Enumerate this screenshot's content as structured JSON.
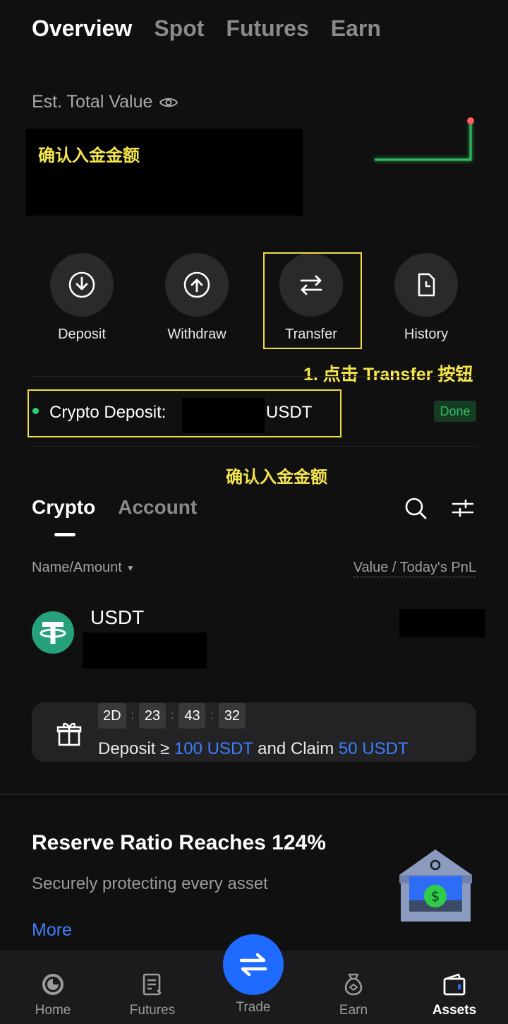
{
  "top_tabs": [
    {
      "label": "Overview"
    },
    {
      "label": "Spot"
    },
    {
      "label": "Futures"
    },
    {
      "label": "Earn"
    }
  ],
  "overview": {
    "est_total_label": "Est. Total Value",
    "annotation_total": "确认入金金额"
  },
  "actions": [
    {
      "label": "Deposit",
      "icon": "download-icon"
    },
    {
      "label": "Withdraw",
      "icon": "upload-icon"
    },
    {
      "label": "Transfer",
      "icon": "transfer-icon"
    },
    {
      "label": "History",
      "icon": "history-icon"
    }
  ],
  "annotation_transfer": "1. 点击 Transfer 按钮",
  "deposit_status": {
    "label": "Crypto Deposit:",
    "unit": "USDT",
    "status": "Done"
  },
  "annotation_amount": "确认入金金额",
  "sub_tabs": [
    {
      "label": "Crypto"
    },
    {
      "label": "Account"
    }
  ],
  "columns": {
    "name": "Name/Amount",
    "value": "Value / Today's PnL"
  },
  "asset": {
    "name": "USDT"
  },
  "promo": {
    "timer": [
      "2D",
      "23",
      "43",
      "32"
    ],
    "text_prefix": "Deposit ≥ ",
    "deposit_amount": "100 USDT",
    "text_mid": " and Claim ",
    "claim_amount": "50 USDT"
  },
  "reserve": {
    "title": "Reserve Ratio Reaches 124%",
    "subtitle": "Securely protecting every asset",
    "more": "More"
  },
  "nav": [
    {
      "label": "Home"
    },
    {
      "label": "Futures"
    },
    {
      "label": "Trade"
    },
    {
      "label": "Earn"
    },
    {
      "label": "Assets"
    }
  ],
  "colors": {
    "accent_blue": "#1f6bff",
    "highlight_yellow": "#f0de3a",
    "success_green": "#2fbf5f"
  }
}
